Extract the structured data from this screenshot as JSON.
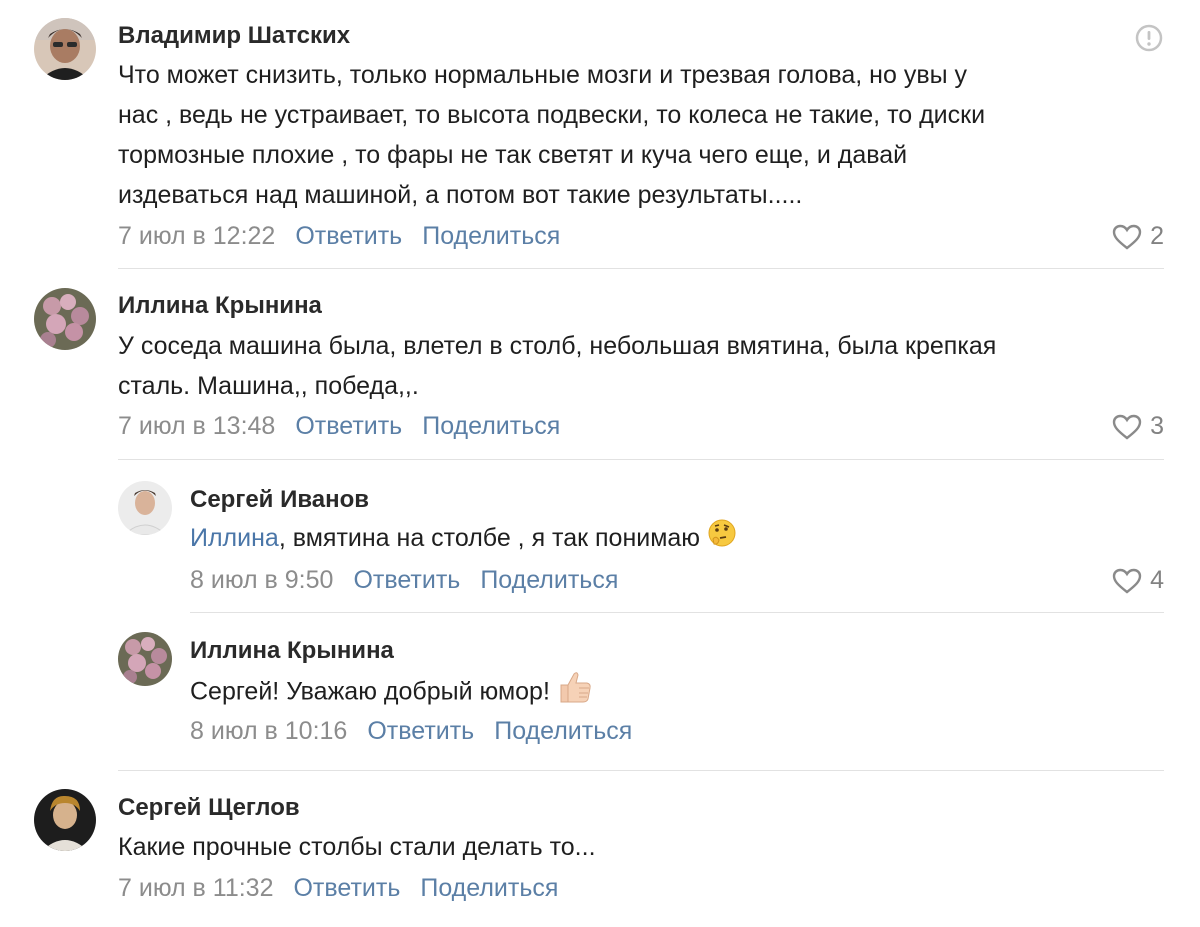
{
  "comments": [
    {
      "author": "Владимир Шатских",
      "lines": [
        "Что может снизить, только нормальные мозги и трезвая голова, но увы у",
        "нас , ведь не устраивает, то высота подвески, то колеса не такие, то диски",
        "тормозные плохие , то фары не так светят и куча чего еще, и давай",
        "издеваться над машиной, а потом вот такие результаты....."
      ],
      "date": "7 июл в 12:22",
      "reply": "Ответить",
      "share": "Поделиться",
      "likes": "2",
      "avatar_icon": "user-photo-avatar",
      "more_icon": "exclamation-circle-icon"
    },
    {
      "author": "Иллина Крынина",
      "lines": [
        "У соседа машина была, влетел в столб, небольшая вмятина, была крепкая",
        "сталь. Машина,, победа,,."
      ],
      "date": "7 июл в 13:48",
      "reply": "Ответить",
      "share": "Поделиться",
      "likes": "3"
    },
    {
      "author": "Сергей Иванов",
      "mention": "Иллина",
      "text": ", вмятина на столбе , я так понимаю",
      "emoji": "thinking-face-icon",
      "date": "8 июл в 9:50",
      "reply": "Ответить",
      "share": "Поделиться",
      "likes": "4"
    },
    {
      "author": "Иллина Крынина",
      "text": "Сергей! Уважаю добрый юмор!",
      "emoji": "thumbs-up-icon",
      "date": "8 июл в 10:16",
      "reply": "Ответить",
      "share": "Поделиться"
    },
    {
      "author": "Сергей Щеглов",
      "text": "Какие прочные столбы стали делать то...",
      "date": "7 июл в 11:32",
      "reply": "Ответить",
      "share": "Поделиться"
    }
  ],
  "colors": {
    "link": "#5b7fa6",
    "mention": "#4a76a8",
    "meta": "#8c8c8c",
    "divider": "#e2e2e2"
  }
}
